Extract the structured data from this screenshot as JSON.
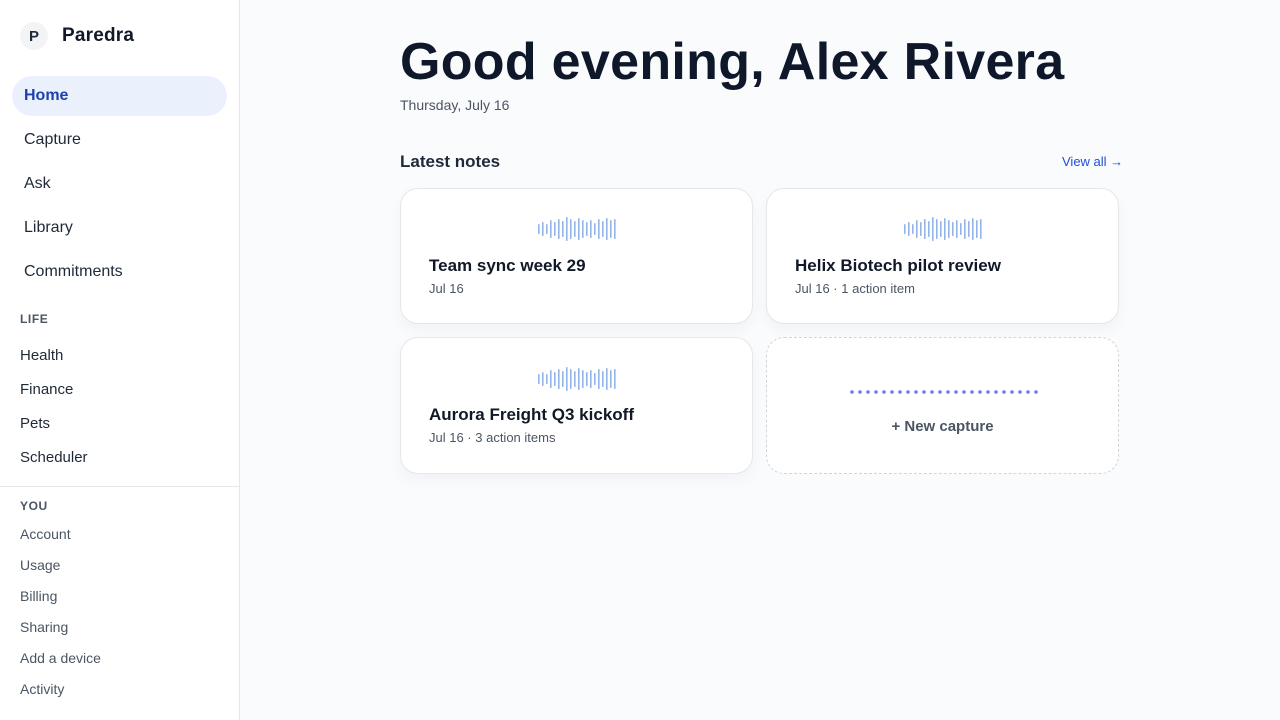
{
  "app": {
    "logo_letter": "P",
    "name": "Paredra"
  },
  "nav": {
    "main": [
      {
        "label": "Home",
        "active": true
      },
      {
        "label": "Capture"
      },
      {
        "label": "Ask"
      },
      {
        "label": "Library"
      },
      {
        "label": "Commitments"
      }
    ],
    "life_label": "LIFE",
    "life": [
      "Health",
      "Finance",
      "Pets",
      "Scheduler"
    ],
    "you_label": "YOU",
    "you": [
      "Account",
      "Usage",
      "Billing",
      "Sharing",
      "Add a device",
      "Activity"
    ]
  },
  "main": {
    "greeting": "Good evening, Alex Rivera",
    "date": "Thursday, July 16",
    "section_title": "Latest notes",
    "view_all": "View all →",
    "notes": [
      {
        "title": "Team sync week 29",
        "meta": "Jul 16",
        "icon": "waveform-icon"
      },
      {
        "title": "Helix Biotech pilot review",
        "meta": "Jul 16 · 1 action item",
        "icon": "waveform-icon"
      },
      {
        "title": "Aurora Freight Q3 kickoff",
        "meta": "Jul 16 · 3 action items",
        "icon": "waveform-icon"
      }
    ],
    "new_capture": "+ New capture"
  },
  "colors": {
    "accent": "#1e40af",
    "active_bg": "#eaf1fd",
    "waveform": "#93b4e8",
    "dots": "#6b7fe0"
  }
}
